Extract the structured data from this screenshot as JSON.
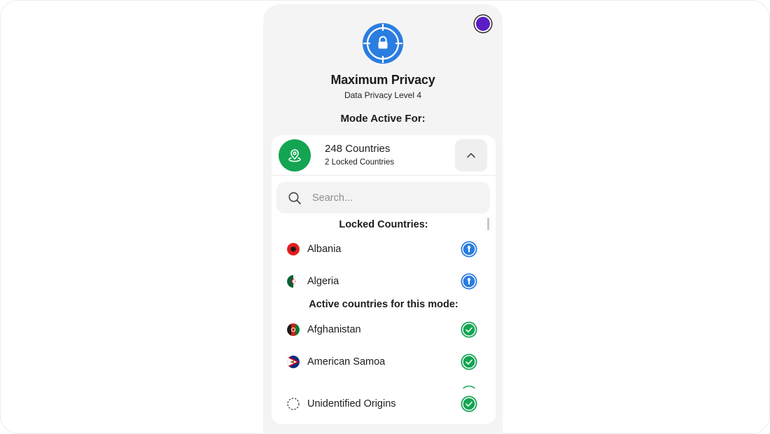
{
  "header": {
    "title": "Maximum Privacy",
    "subtitle": "Data Privacy Level 4",
    "mode_label": "Mode Active For:"
  },
  "icons": {
    "hero": "lock-target-icon",
    "avatar": "profile-dot",
    "location": "location-pin-icon",
    "collapse": "chevron-up-icon",
    "search": "search-icon",
    "locked_status": "lock-keyhole-icon",
    "active_status": "check-circle-icon"
  },
  "countries_summary": {
    "count_label": "248 Countries",
    "locked_label": "2 Locked Countries"
  },
  "search": {
    "placeholder": "Search...",
    "value": ""
  },
  "locked_section": {
    "heading": "Locked Countries:",
    "items": [
      {
        "name": "Albania",
        "flag": "albania-flag",
        "status": "locked"
      },
      {
        "name": "Algeria",
        "flag": "algeria-flag",
        "status": "locked"
      }
    ]
  },
  "active_section": {
    "heading": "Active countries for this mode:",
    "items": [
      {
        "name": "Afghanistan",
        "flag": "afghanistan-flag",
        "status": "active"
      },
      {
        "name": "American Samoa",
        "flag": "american-samoa-flag",
        "status": "active"
      },
      {
        "name": "Unidentified Origins",
        "flag": "dashed-circle",
        "status": "active"
      }
    ]
  },
  "colors": {
    "accent_blue": "#2a7de1",
    "accent_green": "#13a552",
    "avatar_purple": "#5b1ec4",
    "panel_bg": "#f4f4f4"
  }
}
